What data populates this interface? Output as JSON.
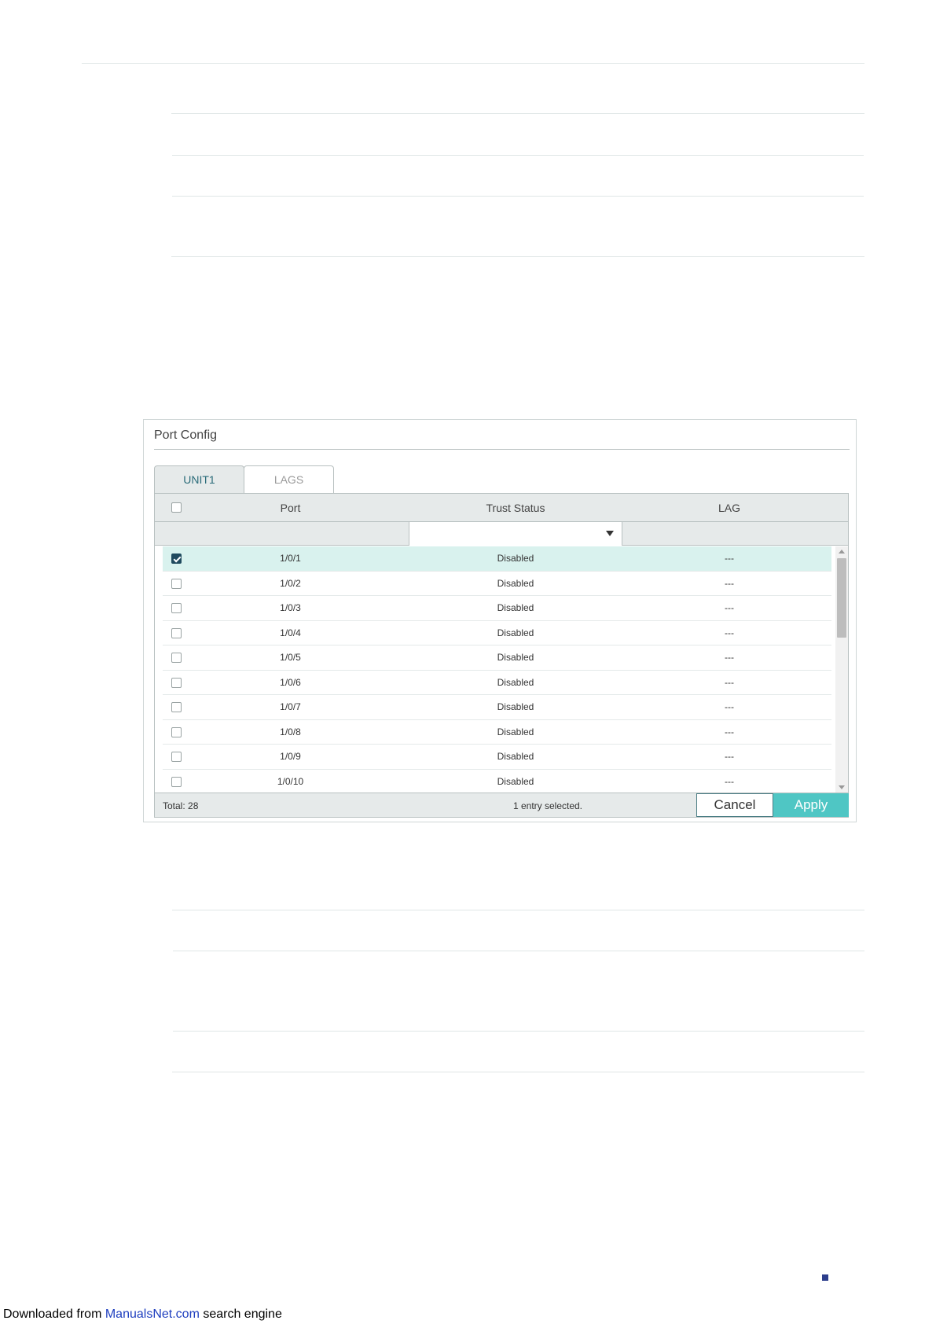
{
  "panel": {
    "title": "Port Config",
    "tabs": [
      {
        "label": "UNIT1",
        "active": true
      },
      {
        "label": "LAGS",
        "active": false
      }
    ],
    "columns": {
      "port": "Port",
      "trust_status": "Trust Status",
      "lag": "LAG"
    },
    "rows": [
      {
        "port": "1/0/1",
        "status": "Disabled",
        "lag": "---",
        "checked": true
      },
      {
        "port": "1/0/2",
        "status": "Disabled",
        "lag": "---",
        "checked": false
      },
      {
        "port": "1/0/3",
        "status": "Disabled",
        "lag": "---",
        "checked": false
      },
      {
        "port": "1/0/4",
        "status": "Disabled",
        "lag": "---",
        "checked": false
      },
      {
        "port": "1/0/5",
        "status": "Disabled",
        "lag": "---",
        "checked": false
      },
      {
        "port": "1/0/6",
        "status": "Disabled",
        "lag": "---",
        "checked": false
      },
      {
        "port": "1/0/7",
        "status": "Disabled",
        "lag": "---",
        "checked": false
      },
      {
        "port": "1/0/8",
        "status": "Disabled",
        "lag": "---",
        "checked": false
      },
      {
        "port": "1/0/9",
        "status": "Disabled",
        "lag": "---",
        "checked": false
      },
      {
        "port": "1/0/10",
        "status": "Disabled",
        "lag": "---",
        "checked": false
      }
    ],
    "footer": {
      "total": "Total: 28",
      "selected": "1 entry selected.",
      "cancel_label": "Cancel",
      "apply_label": "Apply"
    }
  },
  "credit": {
    "prefix": "Downloaded from ",
    "link": "ManualsNet.com",
    "suffix": " search engine"
  },
  "colors": {
    "accent": "#4fc6c4",
    "selected_row": "#d9f2ee",
    "header_bg": "#e6eaea"
  }
}
